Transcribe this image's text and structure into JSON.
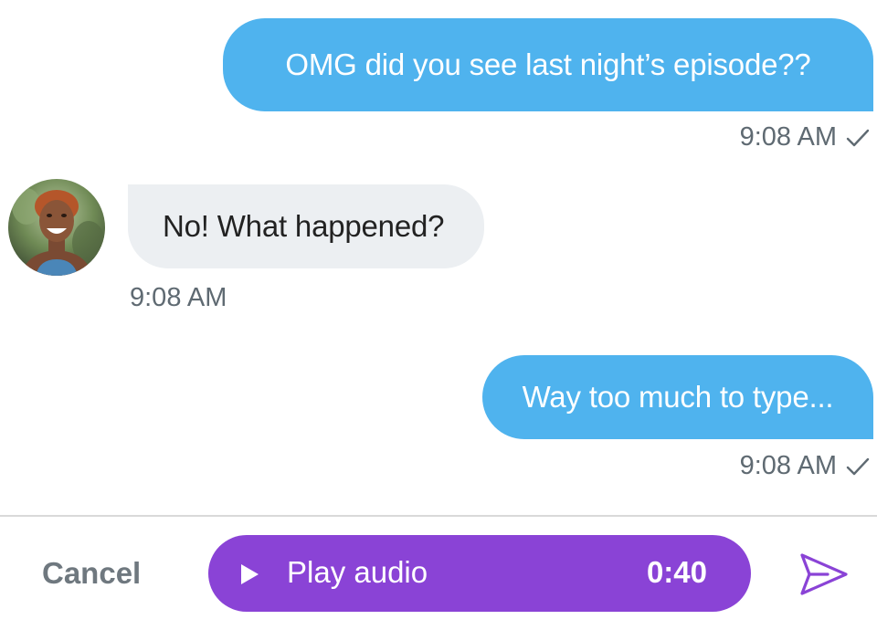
{
  "messages": [
    {
      "direction": "outgoing",
      "text": "OMG did you see last night’s episode??",
      "time": "9:08 AM",
      "status_icon": "check-icon"
    },
    {
      "direction": "incoming",
      "text": "No! What happened?",
      "time": "9:08 AM",
      "avatar_icon": "contact-avatar"
    },
    {
      "direction": "outgoing",
      "text": "Way too much to type...",
      "time": "9:08 AM",
      "status_icon": "check-icon"
    }
  ],
  "composer": {
    "cancel_label": "Cancel",
    "play_icon": "play-icon",
    "play_label": "Play audio",
    "duration": "0:40",
    "send_icon": "send-icon"
  },
  "colors": {
    "outgoing_bubble": "#4fb3ee",
    "incoming_bubble": "#eceff2",
    "audio_pill": "#8a43d6",
    "send_icon": "#8a43d6"
  }
}
